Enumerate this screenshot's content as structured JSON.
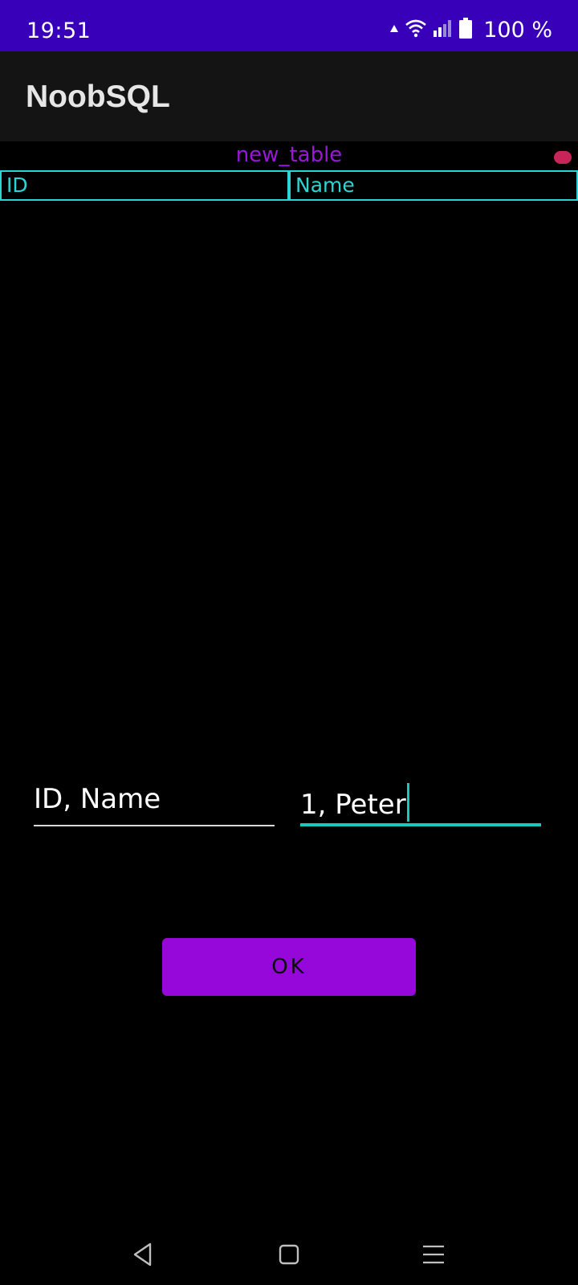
{
  "status_bar": {
    "time": "19:51",
    "battery_percent": "100 %",
    "icons": [
      "data-arrow-icon",
      "wifi-icon",
      "signal-icon",
      "battery-icon"
    ]
  },
  "app_bar": {
    "title": "NoobSQL"
  },
  "table": {
    "name": "new_table",
    "columns": [
      "ID",
      "Name"
    ]
  },
  "form": {
    "columns_value": "ID, Name",
    "values_value": "1, Peter",
    "ok_label": "OK"
  },
  "nav_bar": {
    "icons": [
      "back-icon",
      "home-icon",
      "menu-icon"
    ]
  },
  "colors": {
    "status_bar": "#3800b8",
    "accent_purple": "#9608d9",
    "accent_cyan": "#2cd5d5",
    "record_dot": "#c7245a"
  }
}
